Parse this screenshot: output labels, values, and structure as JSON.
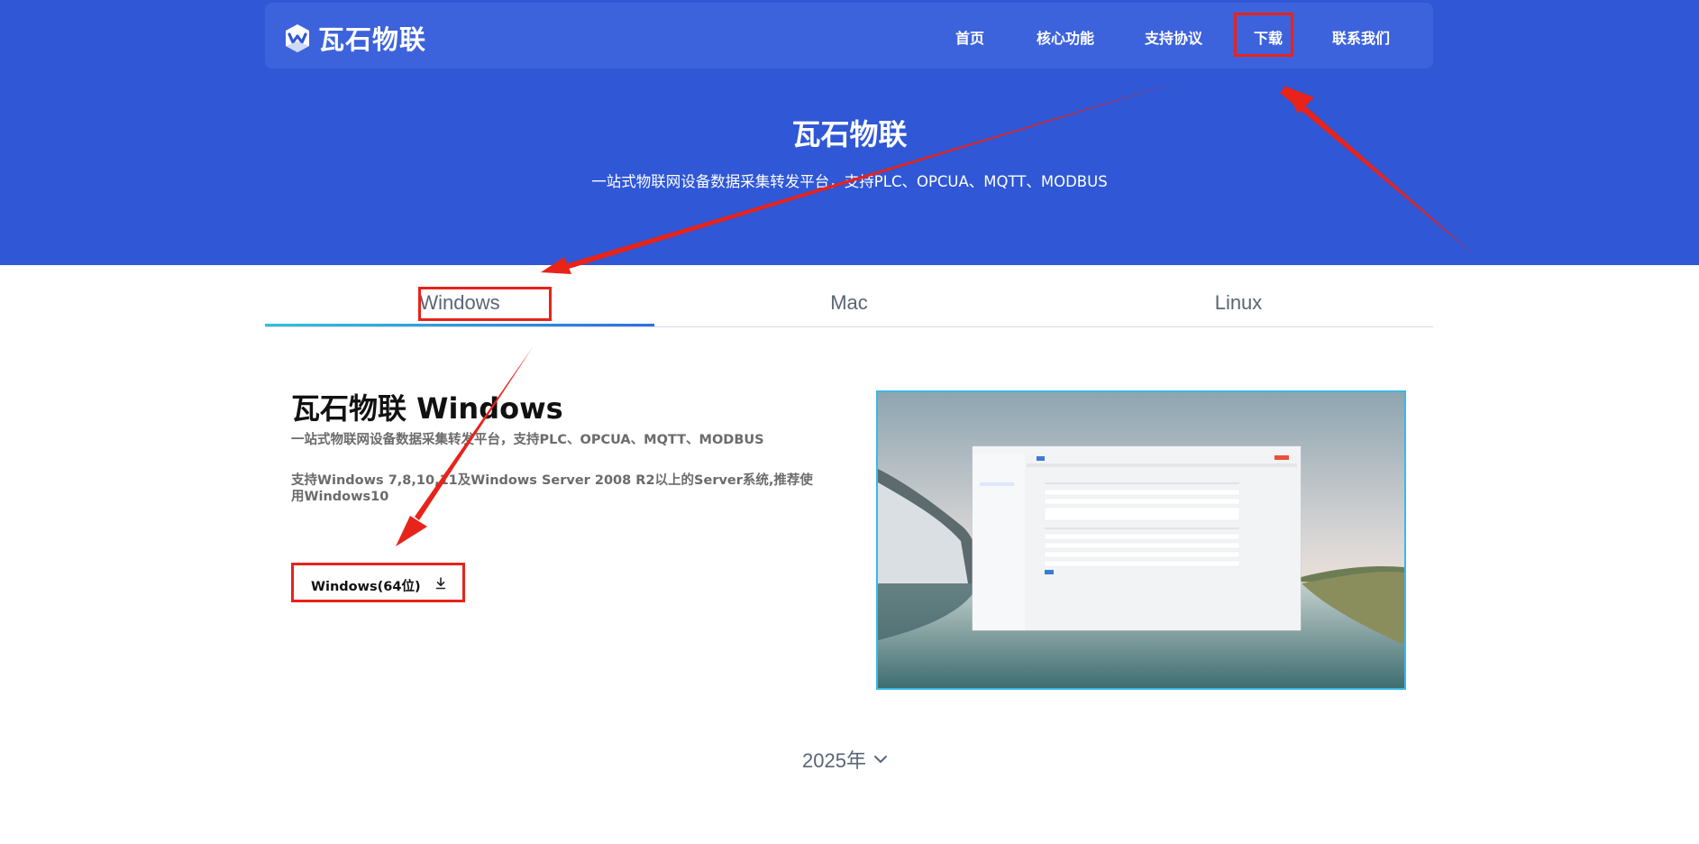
{
  "brand": {
    "name": "瓦石物联"
  },
  "nav": {
    "items": [
      {
        "label": "首页"
      },
      {
        "label": "核心功能"
      },
      {
        "label": "支持协议"
      },
      {
        "label": "下载"
      },
      {
        "label": "联系我们"
      }
    ]
  },
  "hero": {
    "title": "瓦石物联",
    "subtitle": "一站式物联网设备数据采集转发平台，支持PLC、OPCUA、MQTT、MODBUS"
  },
  "tabs": [
    {
      "label": "Windows",
      "active": true
    },
    {
      "label": "Mac",
      "active": false
    },
    {
      "label": "Linux",
      "active": false
    }
  ],
  "product": {
    "title": "瓦石物联 Windows",
    "subtitle": "一站式物联网设备数据采集转发平台，支持PLC、OPCUA、MQTT、MODBUS",
    "description": "支持Windows 7,8,10,11及Windows Server 2008 R2以上的Server系统,推荐使用Windows10",
    "download_label": "Windows(64位)",
    "download_icon": "download-icon"
  },
  "year_selector": {
    "label": "2025年",
    "icon": "chevron-down-icon"
  },
  "colors": {
    "hero_bg": "#2f57d6",
    "nav_bg": "#3d63dc",
    "annotation_red": "#e8231a",
    "tab_active_gradient_start": "#2fc2d8",
    "tab_active_gradient_end": "#2f6fe0"
  }
}
